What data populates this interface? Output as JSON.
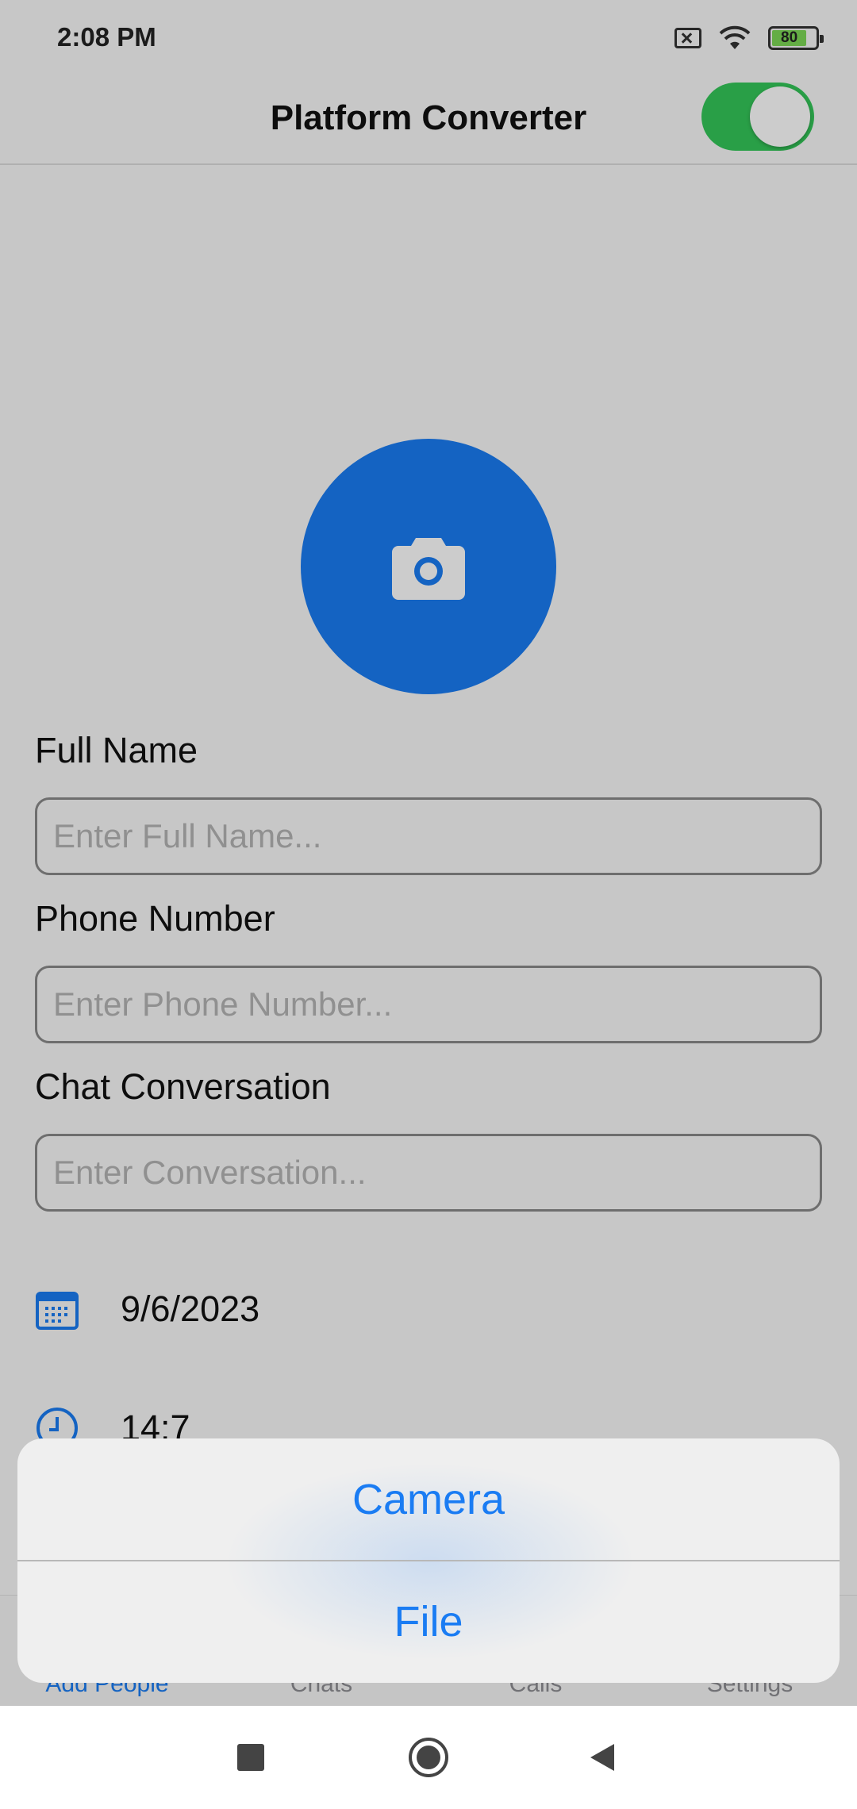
{
  "status_bar": {
    "time": "2:08 PM",
    "battery": "80",
    "icons": [
      "sim-error-icon",
      "wifi-icon",
      "battery-icon"
    ]
  },
  "header": {
    "title": "Platform Converter",
    "toggle_on": true
  },
  "avatar": {
    "icon": "camera-icon"
  },
  "form": {
    "full_name": {
      "label": "Full Name",
      "placeholder": "Enter Full Name...",
      "value": ""
    },
    "phone": {
      "label": "Phone Number",
      "placeholder": "Enter Phone Number...",
      "value": ""
    },
    "conversation": {
      "label": "Chat Conversation",
      "placeholder": "Enter Conversation...",
      "value": ""
    },
    "date": "9/6/2023",
    "time": "14:7"
  },
  "tab_bar": {
    "items": [
      {
        "label": "Add People",
        "active": true
      },
      {
        "label": "Chats",
        "active": false
      },
      {
        "label": "Calls",
        "active": false
      },
      {
        "label": "Settings",
        "active": false
      }
    ]
  },
  "action_sheet": {
    "options": [
      "Camera",
      "File"
    ]
  },
  "nav_bar": {
    "icons": [
      "recents-icon",
      "home-icon",
      "back-icon"
    ]
  },
  "colors": {
    "accent": "#1a7cf3",
    "toggle_on": "#34c759",
    "overlay": "rgba(0,0,0,0.20)"
  }
}
